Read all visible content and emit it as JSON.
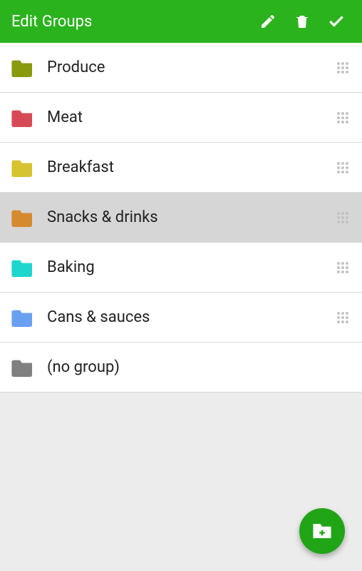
{
  "appbar": {
    "title": "Edit Groups"
  },
  "groups": [
    {
      "label": "Produce",
      "color": "#8a9a0f",
      "hasDrag": true,
      "selected": false
    },
    {
      "label": "Meat",
      "color": "#d64a56",
      "hasDrag": true,
      "selected": false
    },
    {
      "label": "Breakfast",
      "color": "#d6c32f",
      "hasDrag": true,
      "selected": false
    },
    {
      "label": "Snacks & drinks",
      "color": "#d68a2f",
      "hasDrag": true,
      "selected": true
    },
    {
      "label": "Baking",
      "color": "#1fd6cf",
      "hasDrag": true,
      "selected": false
    },
    {
      "label": "Cans & sauces",
      "color": "#6aa0f2",
      "hasDrag": true,
      "selected": false
    },
    {
      "label": "(no group)",
      "color": "#808080",
      "hasDrag": false,
      "selected": false
    }
  ]
}
